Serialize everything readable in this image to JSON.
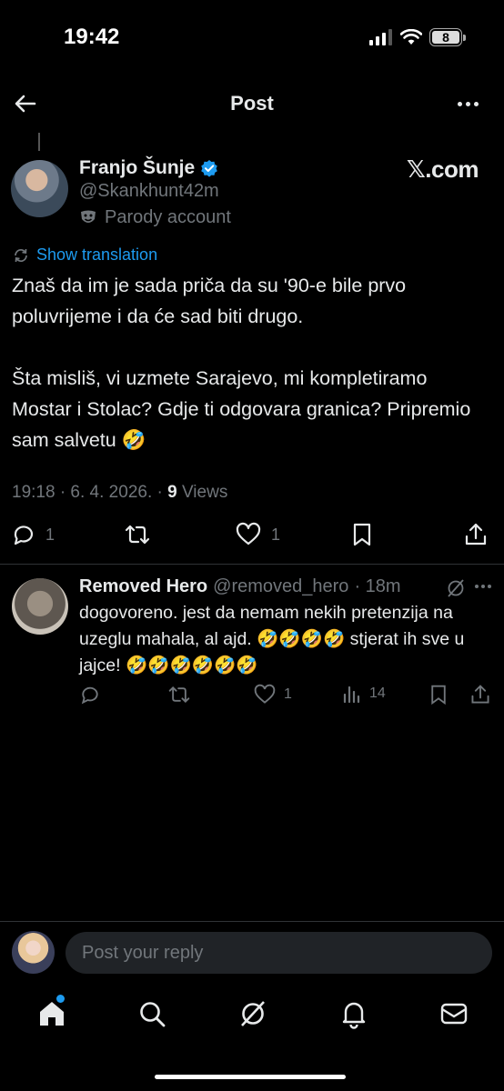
{
  "status_bar": {
    "time": "19:42",
    "battery": "8"
  },
  "header": {
    "title": "Post"
  },
  "post": {
    "author_name": "Franjo Šunje",
    "author_handle": "@Skankhunt42m",
    "parody_label": "Parody account",
    "source_logo": "𝕏.com",
    "show_translation": "Show translation",
    "body": "Znaš da im je sada priča da su '90-e bile prvo poluvrijeme i da će sad biti drugo.\n\nŠta misliš, vi uzmete Sarajevo, mi kompletiramo Mostar i Stolac? Gdje ti odgovara granica? Pripremio sam salvetu 🤣",
    "timestamp": "19:18 · 6. 4. 2026. · ",
    "views_count": "9",
    "views_label": " Views",
    "replies": "1",
    "likes": "1"
  },
  "reply": {
    "name": "Removed Hero",
    "handle": "@removed_hero",
    "time": "· 18m",
    "body": "dogovoreno. jest da nemam nekih pretenzija na uzeglu mahala, al ajd. 🤣🤣🤣🤣 stjerat ih sve u jajce! 🤣🤣🤣🤣🤣🤣",
    "likes": "1",
    "views": "14"
  },
  "composer": {
    "placeholder": "Post your reply"
  },
  "icons": {
    "accent": "#1d9bf0",
    "tabs": [
      "home-icon",
      "search-icon",
      "grok-icon",
      "notifications-icon",
      "messages-icon"
    ]
  }
}
